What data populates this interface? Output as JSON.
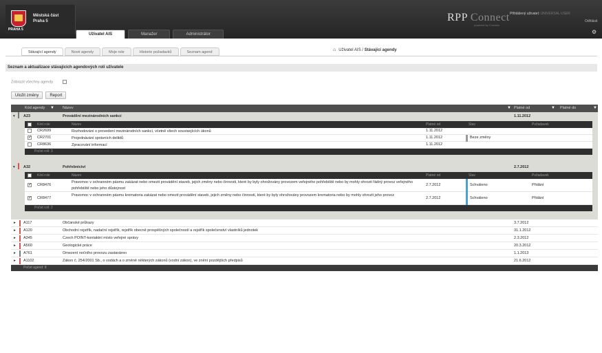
{
  "header": {
    "org_line1": "Městská část",
    "org_line2": "Praha 5",
    "logo_text": "PRAHA 5",
    "brand_a": "RPP",
    "brand_b": "Connect",
    "brand_sub": "powered by Comstar",
    "user_label": "Přihlášený uživatel:",
    "user_name": "UNIVERSAL USER",
    "logout": "Odhlásit",
    "settings_icon": "gear-icon"
  },
  "main_tabs": [
    "Uživatel AIS",
    "Manažer",
    "Administrátor"
  ],
  "sub_tabs": [
    "Stávající agendy",
    "Nové agendy",
    "Moje role",
    "Historie požadavků",
    "Seznam agend"
  ],
  "breadcrumb": {
    "root": "Uživatel AIS",
    "sep": " / ",
    "current": "Stávající agendy",
    "icon": "home-icon"
  },
  "section_title": "Seznam a aktualizace stávajících agendových rolí uživatele",
  "show_all_label": "Zobrazit všechny agendy",
  "buttons": {
    "save": "Uložit změny",
    "report": "Report"
  },
  "grid": {
    "headers": {
      "code": "Kód agendy",
      "name": "Název",
      "valid_from": "Platné od",
      "valid_to": "Platné do"
    },
    "filter_icon": "▼",
    "sub_headers": {
      "code": "Kód role",
      "name": "Název",
      "valid_from": "Platné od",
      "status": "Stav",
      "request": "Požadavek"
    },
    "groups": [
      {
        "code": "A23",
        "name": "Provádění mezinárodních sankcí",
        "date": "1.11.2012",
        "color": "#7a7a7a",
        "roles": [
          {
            "checked": false,
            "code": "CR2699",
            "name": "Rozhodování o provedení mezinárodních sankcí, včetně všech souvisejících úkonů",
            "date": "1.11.2012",
            "status": "",
            "request": ""
          },
          {
            "checked": true,
            "code": "CR2701",
            "name": "Projednávání správních deliktů",
            "date": "1.11.2012",
            "status": "Beze změny",
            "request": ""
          },
          {
            "checked": false,
            "code": "CR8636",
            "name": "Zpracování informací",
            "date": "1.11.2012",
            "status": "",
            "request": ""
          }
        ],
        "footer": "Počet rolí: 3"
      },
      {
        "code": "A32",
        "name": "Pohřebnictví",
        "date": "2.7.2012",
        "color": "#d9534f",
        "roles": [
          {
            "checked": true,
            "code": "CR8476",
            "name": "Pravomoc v ochranném pásmu zakázat nebo omezit provádění staveb, jejich změny nebo činnosti, které by byly ohrožovány provozem veřejného pohřebiště nebo by mohly ohrozit řádný provoz veřejného pohřebiště nebo jeho důstojnost",
            "date": "2.7.2012",
            "status": "Schváleno",
            "request": "Přidání"
          },
          {
            "checked": true,
            "code": "CR8477",
            "name": "Pravomoc v ochranném pásmu krematoria zakázat nebo omezit provádění staveb, jejich změny nebo činnosti, které by byly ohrožovány provozem krematoria nebo by mohly ohrozit jeho provoz",
            "date": "2.7.2012",
            "status": "Schváleno",
            "request": "Přidání"
          }
        ],
        "footer": "Počet rolí: 2"
      }
    ],
    "rows": [
      {
        "code": "A117",
        "name": "Občanské průkazy",
        "date": "3.7.2012",
        "color": "#d9534f"
      },
      {
        "code": "A120",
        "name": "Obchodní rejstřík, nadační rejstřík, rejstřík obecně prospěšných společností a rejstřík společenství vlastníků jednotek",
        "date": "31.1.2012",
        "color": "#d9534f"
      },
      {
        "code": "A345",
        "name": "Czech POINT-kontaktní místo veřejné správy",
        "date": "2.3.2012",
        "color": "#d9534f"
      },
      {
        "code": "A560",
        "name": "Geologické práce",
        "date": "20.3.2012",
        "color": "#d9534f"
      },
      {
        "code": "A761",
        "name": "Omezení nočního provozu zastavárен",
        "date": "1.1.2013",
        "color": "#7a7a7a"
      },
      {
        "code": "A1102",
        "name": "Zákon č. 254/2001 Sb., o vodách a o změně některých zákonů (vodní zákon), ve znění pozdějších předpisů",
        "date": "21.6.2012",
        "color": "#d9534f"
      }
    ],
    "footer": "Počet agend: 8"
  }
}
